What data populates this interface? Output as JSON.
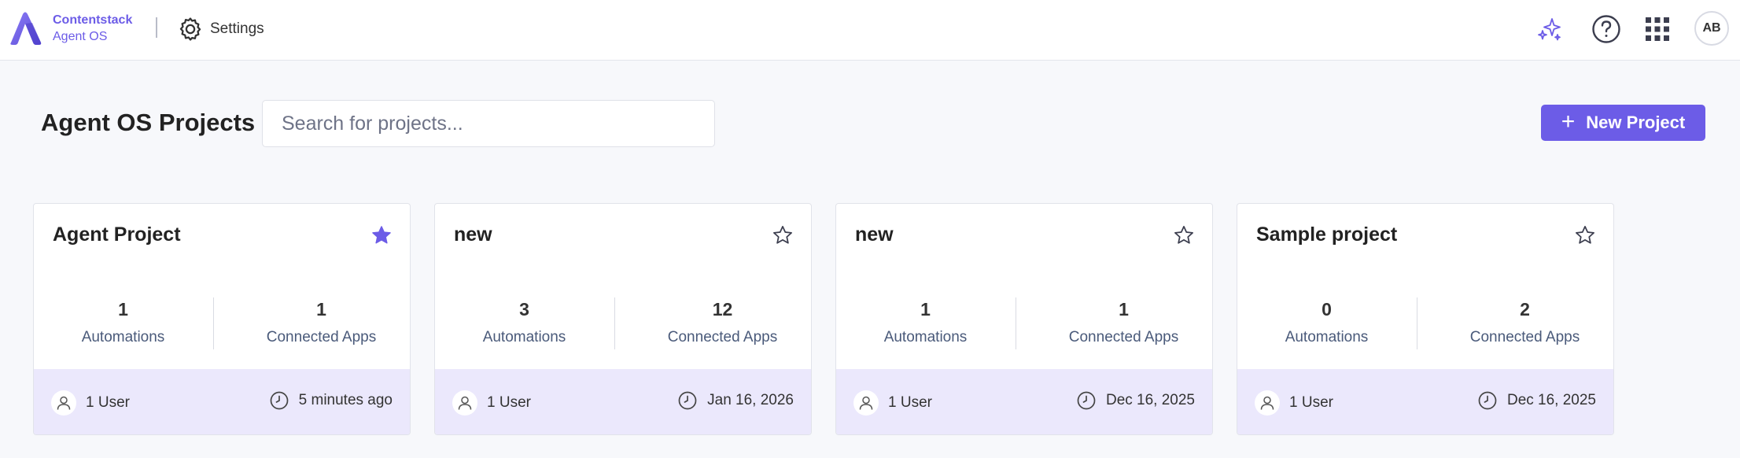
{
  "topbar": {
    "brand_name": "Contentstack",
    "brand_sub": "Agent OS",
    "settings_label": "Settings",
    "icons": [
      "sparkle-icon",
      "help-icon",
      "app-grid-icon"
    ],
    "avatar_initials": "AB"
  },
  "page": {
    "title": "Agent OS Projects",
    "search_placeholder": "Search for projects...",
    "new_project_label": "New Project"
  },
  "colors": {
    "accent": "#6c5ce7",
    "card_footer": "#ebe8fc"
  },
  "cards": [
    {
      "title": "Agent Project",
      "starred": true,
      "automations": "1",
      "automations_label": "Automations",
      "apps": "1",
      "apps_label": "Connected Apps",
      "users": "1 User",
      "updated": "5 minutes ago"
    },
    {
      "title": "new",
      "starred": false,
      "automations": "3",
      "automations_label": "Automations",
      "apps": "12",
      "apps_label": "Connected Apps",
      "users": "1 User",
      "updated": "Jan 16, 2026"
    },
    {
      "title": "new",
      "starred": false,
      "automations": "1",
      "automations_label": "Automations",
      "apps": "1",
      "apps_label": "Connected Apps",
      "users": "1 User",
      "updated": "Dec 16, 2025"
    },
    {
      "title": "Sample project",
      "starred": false,
      "automations": "0",
      "automations_label": "Automations",
      "apps": "2",
      "apps_label": "Connected Apps",
      "users": "1 User",
      "updated": "Dec 16, 2025"
    }
  ]
}
